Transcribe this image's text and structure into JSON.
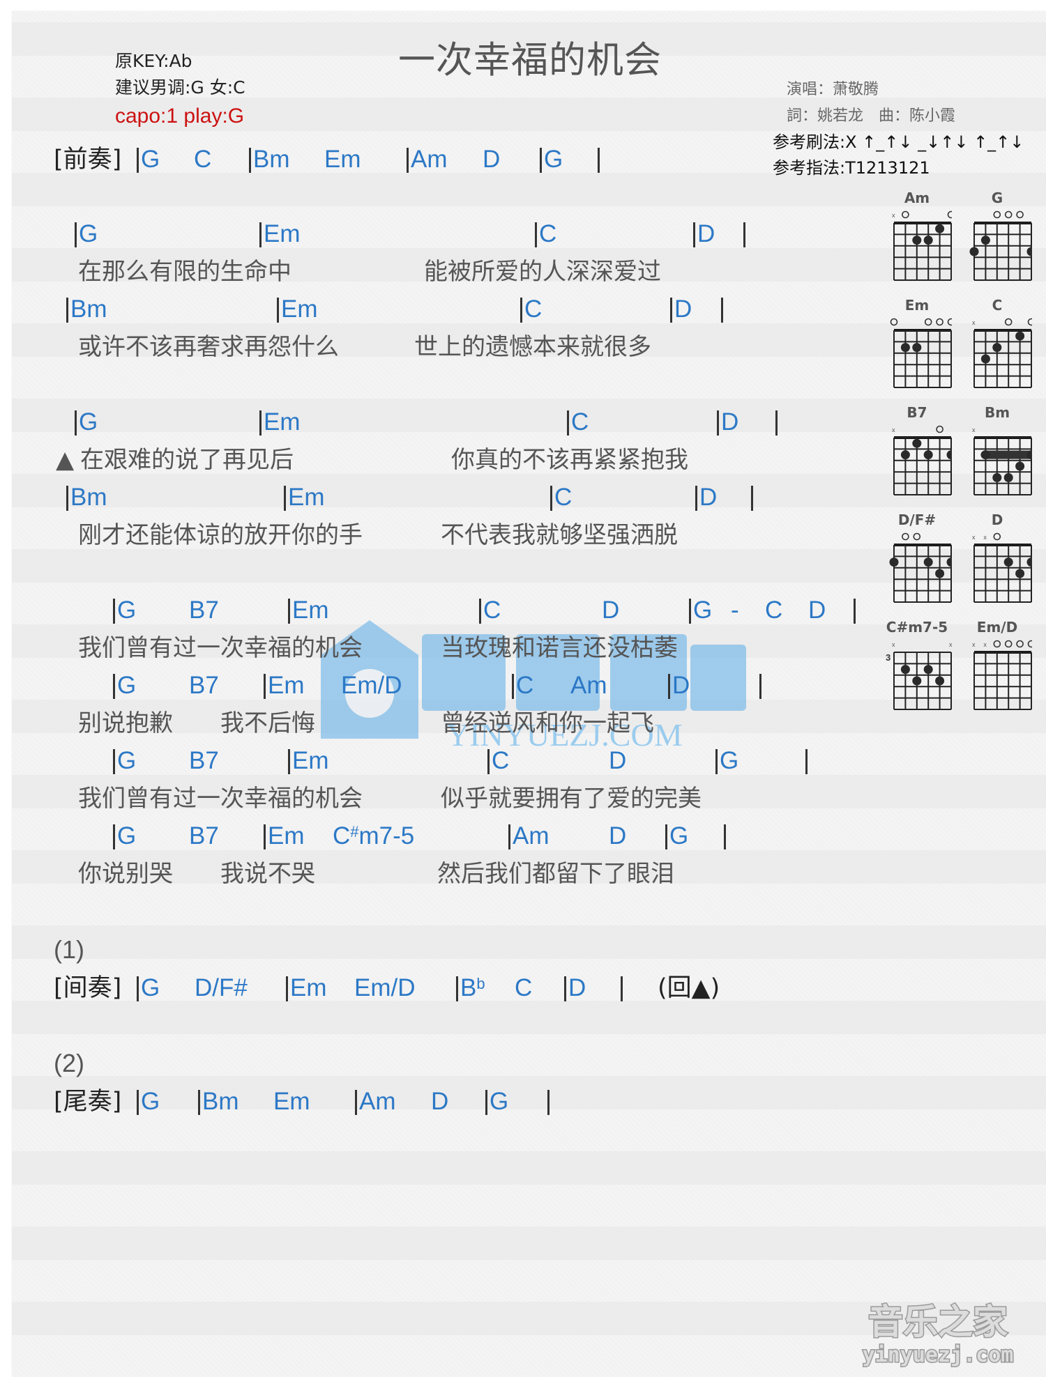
{
  "song": {
    "title": "一次幸福的机会",
    "original_key": "原KEY:Ab",
    "suggested_key": "建议男调:G 女:C",
    "capo": "capo:1 play:G",
    "singer": "演唱：萧敬腾",
    "credits": "詞：姚若龙　曲：陈小霞",
    "strum_pattern": "参考刷法:X ↑_↑↓ _↓↑↓ ↑_↑↓",
    "fingerpick_pattern": "参考指法:T1213121"
  },
  "sections": {
    "intro": {
      "label": "[前奏]",
      "chords": [
        "G",
        "C",
        "Bm",
        "Em",
        "Am",
        "D",
        "G"
      ]
    },
    "verse1": {
      "lines": [
        {
          "chords": [
            "G",
            "Em",
            "C",
            "D"
          ],
          "lyric_a": "在那么有限的生命中",
          "lyric_b": "能被所爱的人深深爱过"
        },
        {
          "chords": [
            "Bm",
            "Em",
            "C",
            "D"
          ],
          "lyric_a": "或许不该再奢求再怨什么",
          "lyric_b": "世上的遗憾本来就很多"
        }
      ]
    },
    "verse2": {
      "marker": "▲",
      "lines": [
        {
          "chords": [
            "G",
            "Em",
            "C",
            "D"
          ],
          "lyric_a": "在艰难的说了再见后",
          "lyric_b": "你真的不该再紧紧抱我"
        },
        {
          "chords": [
            "Bm",
            "Em",
            "C",
            "D"
          ],
          "lyric_a": "刚才还能体谅的放开你的手",
          "lyric_b": "不代表我就够坚强洒脱"
        }
      ]
    },
    "chorus": {
      "lines": [
        {
          "chords": [
            "G",
            "B7",
            "Em",
            "C",
            "D",
            "G",
            "-",
            "C",
            "D"
          ],
          "lyric_a": "我们曾有过一次幸福的机会",
          "lyric_b": "当玫瑰和诺言还没枯萎"
        },
        {
          "chords": [
            "G",
            "B7",
            "Em",
            "Em/D",
            "C",
            "Am",
            "D"
          ],
          "lyric_a": "别说抱歉　　我不后悔",
          "lyric_b": "曾经逆风和你一起飞"
        },
        {
          "chords": [
            "G",
            "B7",
            "Em",
            "C",
            "D",
            "G"
          ],
          "lyric_a": "我们曾有过一次幸福的机会",
          "lyric_b": "似乎就要拥有了爱的完美"
        },
        {
          "chords": [
            "G",
            "B7",
            "Em",
            "C#m7-5",
            "Am",
            "D",
            "G"
          ],
          "lyric_a": "你说别哭　　我说不哭",
          "lyric_b": "然后我们都留下了眼泪"
        }
      ]
    },
    "ending1": {
      "marker": "(1)",
      "label": "[间奏]",
      "chords": [
        "G",
        "D/F#",
        "Em",
        "Em/D",
        "Bb",
        "C",
        "D"
      ],
      "repeat_note": "(回▲)"
    },
    "ending2": {
      "marker": "(2)",
      "label": "[尾奏]",
      "chords": [
        "G",
        "Bm",
        "Em",
        "Am",
        "D",
        "G"
      ]
    }
  },
  "chord_diagrams": [
    {
      "name": "Am",
      "strings": [
        "x",
        "0",
        "2",
        "2",
        "1",
        "0"
      ]
    },
    {
      "name": "G",
      "strings": [
        "3",
        "2",
        "0",
        "0",
        "0",
        "3"
      ]
    },
    {
      "name": "Em",
      "strings": [
        "0",
        "2",
        "2",
        "0",
        "0",
        "0"
      ]
    },
    {
      "name": "C",
      "strings": [
        "x",
        "3",
        "2",
        "0",
        "1",
        "0"
      ]
    },
    {
      "name": "B7",
      "strings": [
        "x",
        "2",
        "1",
        "2",
        "0",
        "2"
      ]
    },
    {
      "name": "Bm",
      "strings": [
        "x",
        "2",
        "4",
        "4",
        "3",
        "2"
      ],
      "barre": "fret 2"
    },
    {
      "name": "D/F#",
      "strings": [
        "2",
        "0",
        "0",
        "2",
        "3",
        "2"
      ]
    },
    {
      "name": "D",
      "strings": [
        "x",
        "x",
        "0",
        "2",
        "3",
        "2"
      ]
    },
    {
      "name": "C#m7-5",
      "strings": [
        "x",
        "4",
        "5",
        "4",
        "5",
        "x"
      ],
      "base_fret": "3"
    },
    {
      "name": "Em/D",
      "strings": [
        "x",
        "x",
        "0",
        "0",
        "0",
        "0"
      ]
    }
  ],
  "watermark": {
    "text": "音乐之家",
    "subtext": "YINYUEZJ.COM"
  },
  "logo": {
    "text": "音乐之家",
    "url_text": "yinyuezj.com"
  },
  "colors": {
    "chord": "#2c78c6",
    "capo": "#cc1111",
    "lyric": "#555555",
    "barline": "#333333"
  }
}
